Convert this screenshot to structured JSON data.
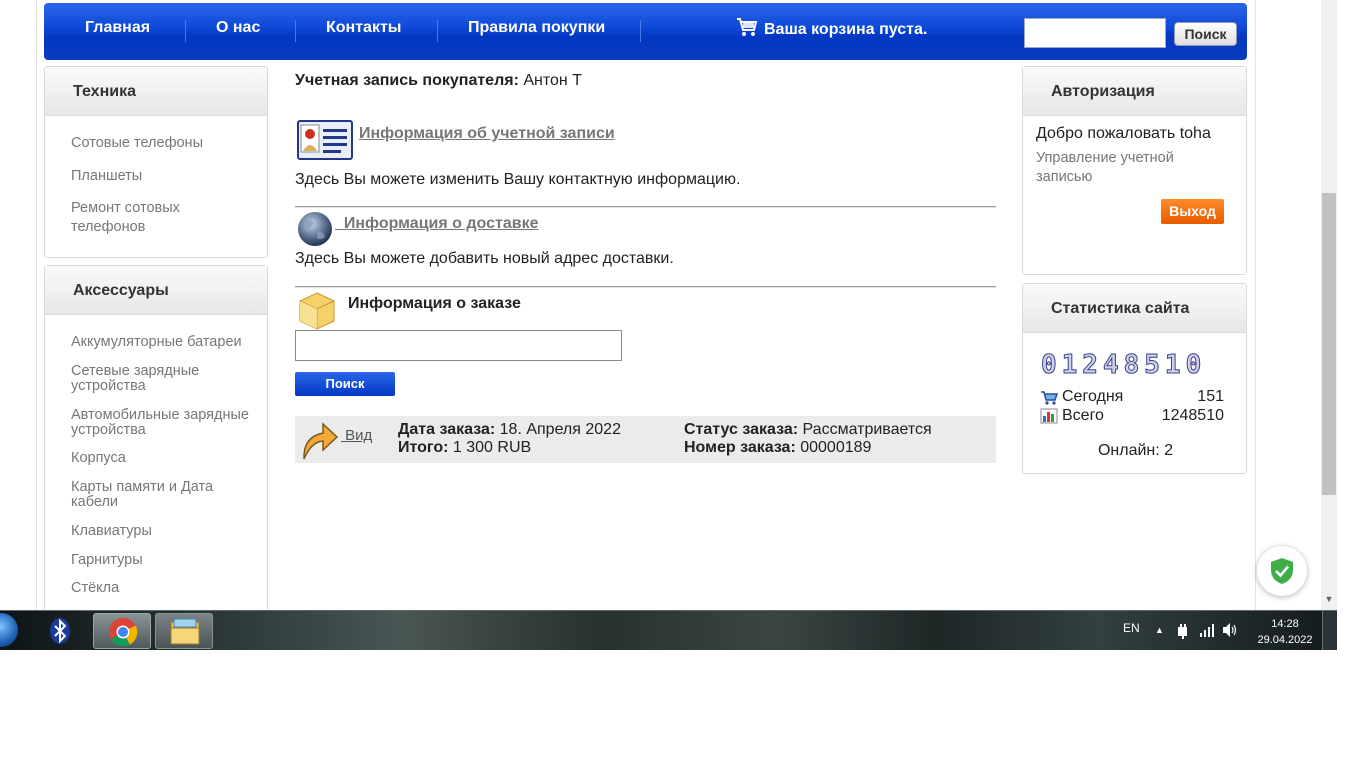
{
  "nav": {
    "items": [
      "Главная",
      "О нас",
      "Контакты",
      "Правила покупки"
    ],
    "cart_text": "Ваша корзина пуста.",
    "search_button": "Поиск"
  },
  "sidebar": {
    "boxes": [
      {
        "title": "Техника",
        "items": [
          "Сотовые телефоны",
          "Планшеты",
          "Ремонт сотовых телефонов"
        ]
      },
      {
        "title": "Аксессуары",
        "items": [
          "Аккумуляторные батареи",
          "Сетевые зарядные устройства",
          "Автомобильные зарядные устройства",
          "Корпуса",
          "Карты памяти и Дата кабели",
          "Клавиатуры",
          "Гарнитуры",
          "Стёкла"
        ]
      }
    ]
  },
  "main": {
    "account_label": "Учетная запись покупателя:",
    "account_name": "Антон Т",
    "account_info_link": "Информация об учетной записи",
    "account_info_desc": "Здесь Вы можете изменить Вашу контактную информацию.",
    "delivery_link": "Информация о доставке",
    "delivery_desc": "Здесь Вы можете добавить новый адрес доставки.",
    "order_info_title": "Информация о заказе",
    "order_search_button": "Поиск",
    "order": {
      "view_link": "Вид",
      "date_label": "Дата заказа:",
      "date_value": "18. Апреля 2022",
      "total_label": "Итого:",
      "total_value": "1 300 RUB",
      "status_label": "Статус заказа:",
      "status_value": "Рассматривается",
      "number_label": "Номер заказа:",
      "number_value": "00000189"
    }
  },
  "right": {
    "auth_title": "Авторизация",
    "welcome": "Добро пожаловать toha",
    "manage_account": "Управление учетной записью",
    "logout": "Выход",
    "stats_title": "Статистика сайта",
    "counter": "01248510",
    "today_label": "Сегодня",
    "today_value": "151",
    "total_label": "Всего",
    "total_value": "1248510",
    "online": "Онлайн: 2"
  },
  "taskbar": {
    "lang": "EN",
    "time": "14:28",
    "date": "29.04.2022"
  },
  "colors": {
    "nav_blue": "#0d47d8",
    "logout_orange": "#f07010",
    "link_gray": "#777777"
  }
}
